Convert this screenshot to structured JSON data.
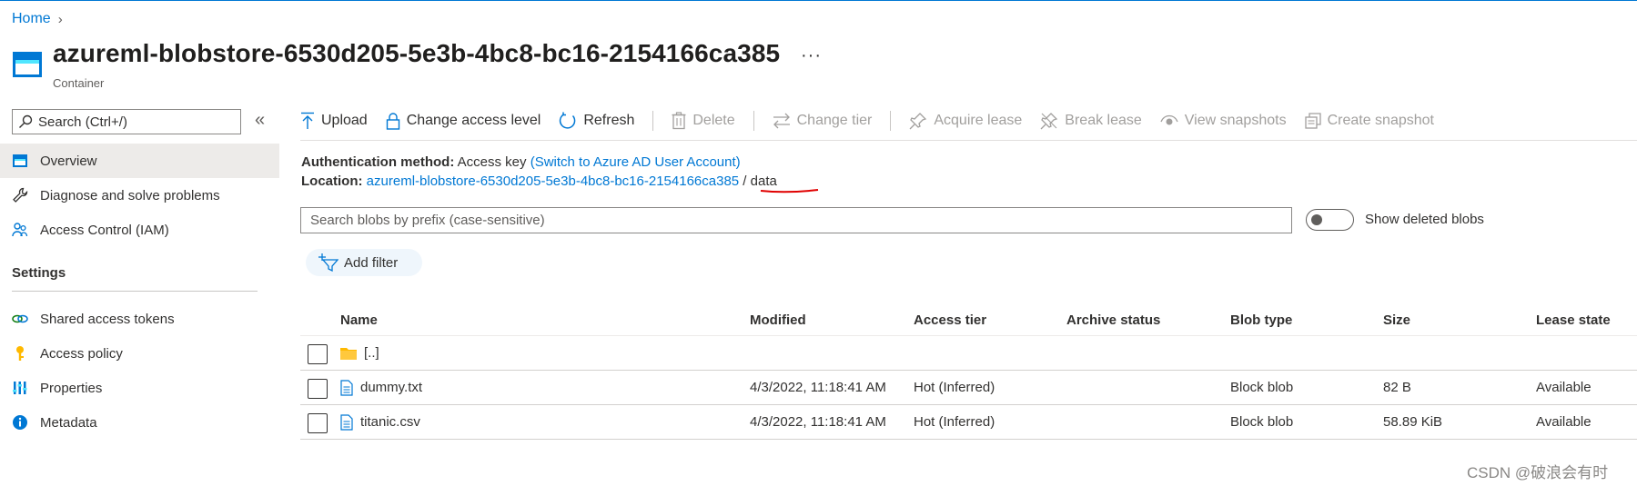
{
  "breadcrumb": {
    "home": "Home",
    "separator": "›"
  },
  "resource": {
    "title": "azureml-blobstore-6530d205-5e3b-4bc8-bc16-2154166ca385",
    "subtitle": "Container",
    "more": "···"
  },
  "sidebar": {
    "search_placeholder": "Search (Ctrl+/)",
    "collapse_icon": "«",
    "items": [
      {
        "label": "Overview",
        "icon": "overview-icon"
      },
      {
        "label": "Diagnose and solve problems",
        "icon": "wrench-icon"
      },
      {
        "label": "Access Control (IAM)",
        "icon": "people-icon"
      }
    ],
    "settings_header": "Settings",
    "settings_items": [
      {
        "label": "Shared access tokens",
        "icon": "link-icon"
      },
      {
        "label": "Access policy",
        "icon": "key-icon"
      },
      {
        "label": "Properties",
        "icon": "properties-icon"
      },
      {
        "label": "Metadata",
        "icon": "info-icon"
      }
    ]
  },
  "toolbar": {
    "upload": "Upload",
    "change_access": "Change access level",
    "refresh": "Refresh",
    "delete": "Delete",
    "change_tier": "Change tier",
    "acquire_lease": "Acquire lease",
    "break_lease": "Break lease",
    "view_snapshots": "View snapshots",
    "create_snapshot": "Create snapshot"
  },
  "info": {
    "auth_label": "Authentication method:",
    "auth_value": "Access key",
    "auth_link": "(Switch to Azure AD User Account)",
    "location_label": "Location:",
    "location_link": "azureml-blobstore-6530d205-5e3b-4bc8-bc16-2154166ca385",
    "location_sep": "/",
    "location_folder": "data"
  },
  "blob_search": {
    "placeholder": "Search blobs by prefix (case-sensitive)"
  },
  "toggle": {
    "label": "Show deleted blobs",
    "on": false
  },
  "add_filter": "Add filter",
  "table": {
    "headers": {
      "name": "Name",
      "modified": "Modified",
      "access_tier": "Access tier",
      "archive_status": "Archive status",
      "blob_type": "Blob type",
      "size": "Size",
      "lease_state": "Lease state"
    },
    "rows": [
      {
        "name": "[..]",
        "type": "folder",
        "modified": "",
        "access_tier": "",
        "archive_status": "",
        "blob_type": "",
        "size": "",
        "lease_state": ""
      },
      {
        "name": "dummy.txt",
        "type": "file",
        "modified": "4/3/2022, 11:18:41 AM",
        "access_tier": "Hot (Inferred)",
        "archive_status": "",
        "blob_type": "Block blob",
        "size": "82 B",
        "lease_state": "Available"
      },
      {
        "name": "titanic.csv",
        "type": "file",
        "modified": "4/3/2022, 11:18:41 AM",
        "access_tier": "Hot (Inferred)",
        "archive_status": "",
        "blob_type": "Block blob",
        "size": "58.89 KiB",
        "lease_state": "Available"
      }
    ]
  },
  "watermark": "CSDN @破浪会有时",
  "colors": {
    "accent": "#0078d4",
    "annotation": "#e00000",
    "folder": "#ffb900"
  }
}
